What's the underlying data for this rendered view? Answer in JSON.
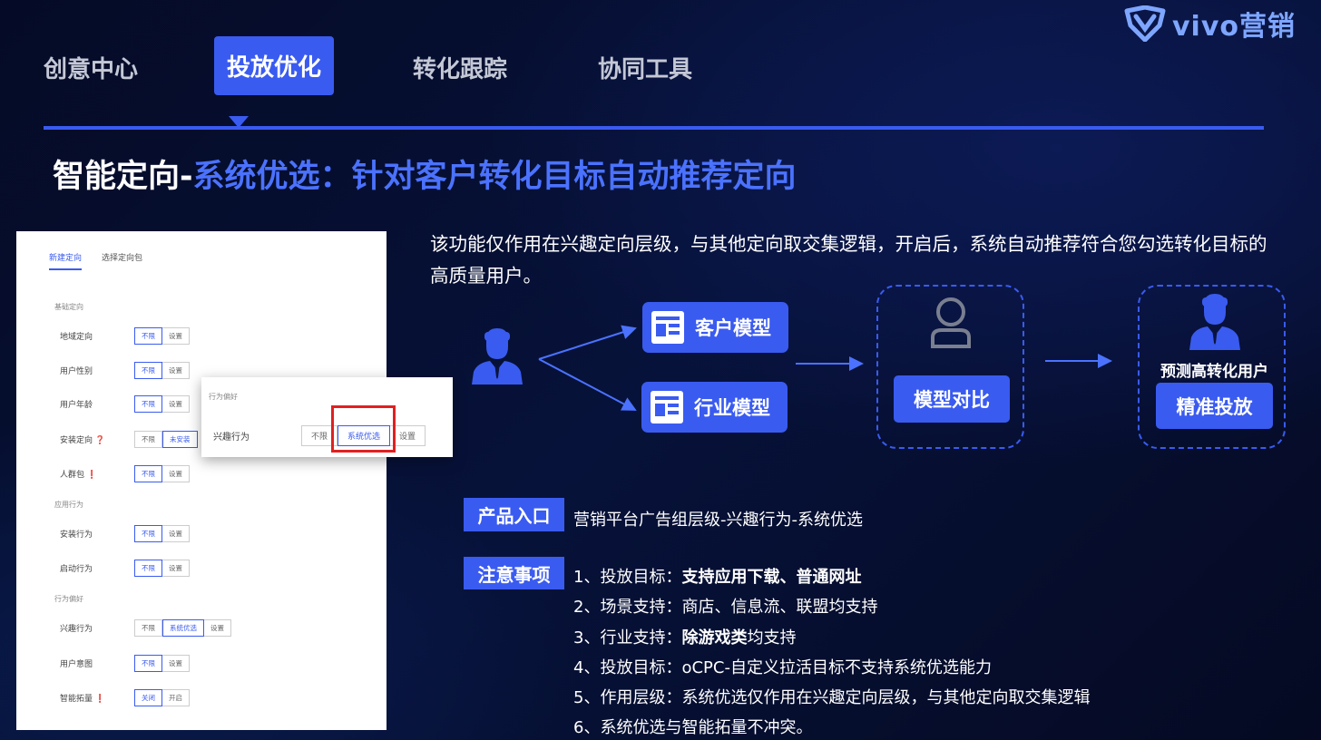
{
  "brand": {
    "logo_text": "vivo营销"
  },
  "tabs": [
    {
      "label": "创意中心",
      "active": false
    },
    {
      "label": "投放优化",
      "active": true
    },
    {
      "label": "转化跟踪",
      "active": false
    },
    {
      "label": "协同工具",
      "active": false
    }
  ],
  "headline": {
    "white": "智能定向-",
    "blue": "系统优选：针对客户转化目标自动推荐定向"
  },
  "screenshot": {
    "tabs": [
      "新建定向",
      "选择定向包"
    ],
    "sections": {
      "basic": "基础定向",
      "app": "应用行为",
      "behavior": "行为偏好"
    },
    "rows": [
      {
        "label": "地域定向",
        "options": [
          "不限",
          "设置"
        ]
      },
      {
        "label": "用户性别",
        "options": [
          "不限",
          "设置"
        ]
      },
      {
        "label": "用户年龄",
        "options": [
          "不限",
          "设置"
        ]
      },
      {
        "label": "安装定向 ❓",
        "options": [
          "不限",
          "未安装"
        ]
      },
      {
        "label": "人群包 ❗",
        "options": [
          "不限",
          "设置"
        ]
      },
      {
        "label": "安装行为",
        "options": [
          "不限",
          "设置"
        ]
      },
      {
        "label": "启动行为",
        "options": [
          "不限",
          "设置"
        ]
      },
      {
        "label": "兴趣行为",
        "options": [
          "不限",
          "系统优选",
          "设置"
        ]
      },
      {
        "label": "用户意图",
        "options": [
          "不限",
          "设置"
        ]
      },
      {
        "label": "智能拓量 ❗",
        "options": [
          "关闭",
          "开启"
        ]
      }
    ],
    "popup": {
      "title": "行为偏好",
      "label": "兴趣行为",
      "options": [
        "不限",
        "系统优选",
        "设置"
      ]
    }
  },
  "description": "该功能仅作用在兴趣定向层级，与其他定向取交集逻辑，开启后，系统自动推荐符合您勾选转化目标的高质量用户。",
  "flow": {
    "customer_model": "客户模型",
    "industry_model": "行业模型",
    "compare": "模型对比",
    "predict": "预测高转化用户",
    "precise": "精准投放"
  },
  "entry": {
    "tag": "产品入口",
    "text": "营销平台广告组层级-兴趣行为-系统优选"
  },
  "notes": {
    "tag": "注意事项",
    "items": [
      {
        "prefix": "1、投放目标：",
        "bold": "支持应用下载、普通网址",
        "suffix": ""
      },
      {
        "prefix": "2、场景支持：商店、信息流、联盟均支持",
        "bold": "",
        "suffix": ""
      },
      {
        "prefix": "3、行业支持：",
        "bold": "除游戏类",
        "suffix": "均支持"
      },
      {
        "prefix": "4、投放目标：oCPC-自定义拉活目标不支持系统优选能力",
        "bold": "",
        "suffix": ""
      },
      {
        "prefix": "5、作用层级：系统优选仅作用在兴趣定向层级，与其他定向取交集逻辑",
        "bold": "",
        "suffix": ""
      },
      {
        "prefix": "6、系统优选与智能拓量不冲突。",
        "bold": "",
        "suffix": ""
      }
    ]
  },
  "colors": {
    "accent": "#3a5bf0",
    "highlight": "#e02020",
    "background": "#060d2e"
  }
}
